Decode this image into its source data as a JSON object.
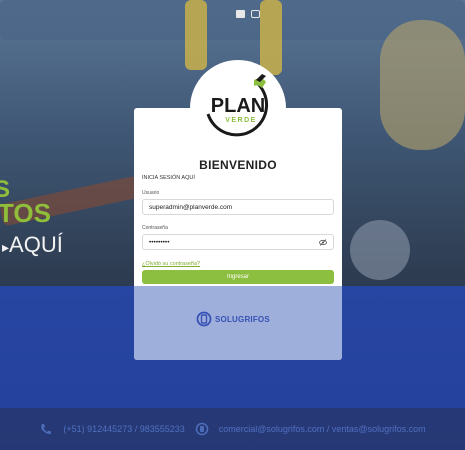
{
  "hero": {
    "line1": "S",
    "line2": "TOS",
    "line3": "AQUÍ"
  },
  "login": {
    "logo_main": "PLAN",
    "logo_sub": "VERDE",
    "title": "BIENVENIDO",
    "subtitle": "INICIA SESIÓN AQUÍ",
    "user_label": "Usuario",
    "user_value": "superadmin@planverde.com",
    "pass_label": "Contraseña",
    "pass_value": "•••••••••",
    "forgot": "¿Olvidó su contraseña?",
    "submit": "Ingresar",
    "brand": "SOLUGRIFOS"
  },
  "footer": {
    "phones": "(+51) 912445273 / 983555233",
    "emails": "comercial@solugrifos.com / ventas@solugrifos.com"
  },
  "colors": {
    "accent_green": "#8cbf3f",
    "brand_blue": "#3551b4"
  }
}
